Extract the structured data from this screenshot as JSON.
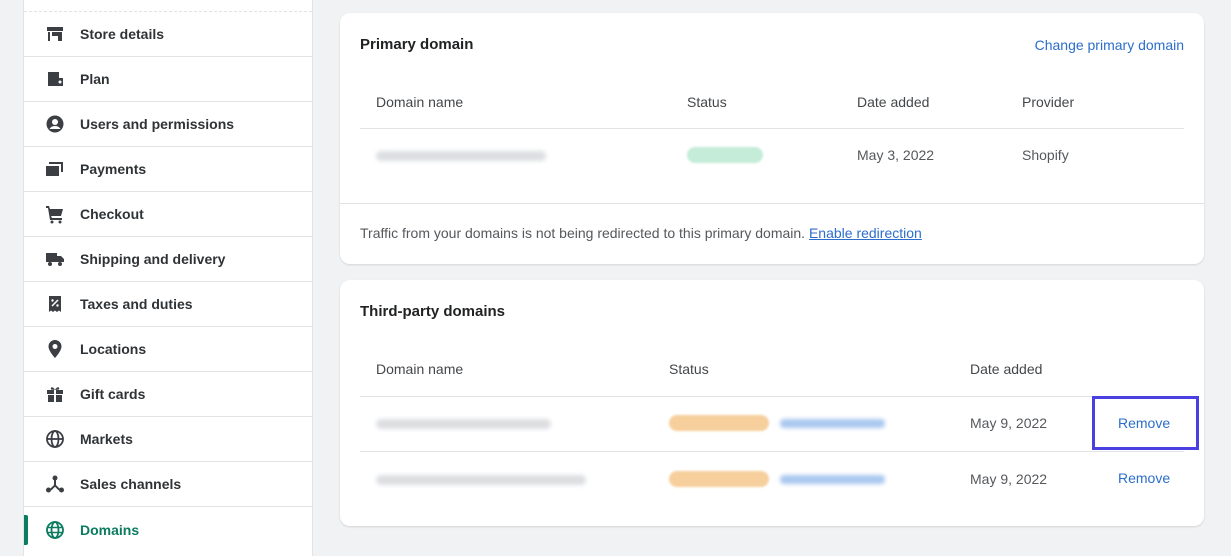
{
  "sidebar": {
    "items": [
      {
        "label": "Store details",
        "icon": "store-icon"
      },
      {
        "label": "Plan",
        "icon": "plan-icon"
      },
      {
        "label": "Users and permissions",
        "icon": "user-icon"
      },
      {
        "label": "Payments",
        "icon": "payments-icon"
      },
      {
        "label": "Checkout",
        "icon": "cart-icon"
      },
      {
        "label": "Shipping and delivery",
        "icon": "truck-icon"
      },
      {
        "label": "Taxes and duties",
        "icon": "tax-icon"
      },
      {
        "label": "Locations",
        "icon": "location-pin-icon"
      },
      {
        "label": "Gift cards",
        "icon": "gift-icon"
      },
      {
        "label": "Markets",
        "icon": "globe-icon"
      },
      {
        "label": "Sales channels",
        "icon": "channels-icon"
      },
      {
        "label": "Domains",
        "icon": "domains-globe-icon",
        "active": true
      }
    ]
  },
  "primary": {
    "title": "Primary domain",
    "change_link": "Change primary domain",
    "headers": {
      "domain": "Domain name",
      "status": "Status",
      "date": "Date added",
      "provider": "Provider"
    },
    "row": {
      "date": "May 3, 2022",
      "provider": "Shopify"
    },
    "footer_text": "Traffic from your domains is not being redirected to this primary domain.",
    "footer_link": "Enable redirection"
  },
  "third_party": {
    "title": "Third-party domains",
    "headers": {
      "domain": "Domain name",
      "status": "Status",
      "date": "Date added"
    },
    "rows": [
      {
        "date": "May 9, 2022",
        "action": "Remove"
      },
      {
        "date": "May 9, 2022",
        "action": "Remove"
      }
    ]
  },
  "colors": {
    "accent": "#0b7c60",
    "link": "#2c6ecb",
    "highlight": "#4a3fe0"
  }
}
